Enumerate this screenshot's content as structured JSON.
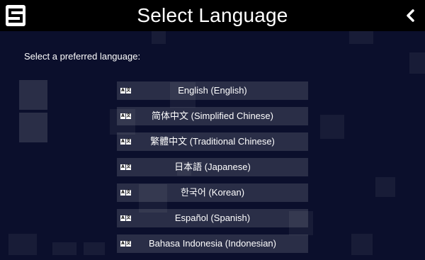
{
  "header": {
    "title": "Select Language",
    "back_icon": "chevron-left-icon",
    "logo_icon": "app-logo-s"
  },
  "prompt": "Select a preferred language:",
  "languages": [
    {
      "label": "English (English)",
      "icon": "language-icon"
    },
    {
      "label": "简体中文 (Simplified Chinese)",
      "icon": "language-icon"
    },
    {
      "label": "繁體中文 (Traditional Chinese)",
      "icon": "language-icon"
    },
    {
      "label": "日本語 (Japanese)",
      "icon": "language-icon"
    },
    {
      "label": "한국어 (Korean)",
      "icon": "language-icon"
    },
    {
      "label": "Español (Spanish)",
      "icon": "language-icon"
    },
    {
      "label": "Bahasa Indonesia (Indonesian)",
      "icon": "language-icon"
    }
  ],
  "colors": {
    "background": "#0b0f2c",
    "header": "#000000",
    "item_bg": "rgba(255,255,255,0.13)",
    "text": "#ffffff"
  }
}
